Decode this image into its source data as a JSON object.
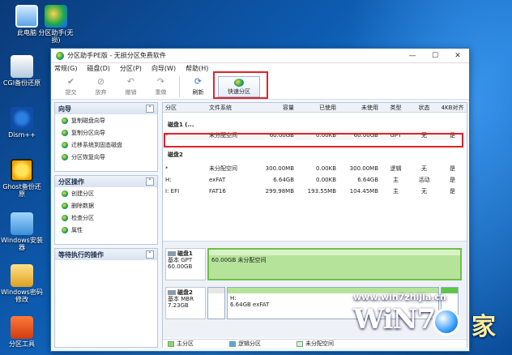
{
  "desktop_icons": [
    {
      "name": "computer",
      "label": "此电脑",
      "icon": "computer-icon"
    },
    {
      "name": "partition-assistant",
      "label": "分区助手(无损)",
      "icon": "partition-icon"
    },
    {
      "name": "cgi",
      "label": "CGI备份还原",
      "icon": "ghost-icon"
    },
    {
      "name": "dism",
      "label": "Dism++",
      "icon": "gear-icon"
    },
    {
      "name": "ghost",
      "label": "Ghost备份还原",
      "icon": "smile-icon"
    },
    {
      "name": "windows-setup",
      "label": "Windows安装器",
      "icon": "setup-icon"
    },
    {
      "name": "windows-password",
      "label": "Windows密码修改",
      "icon": "key-icon"
    },
    {
      "name": "partition-tool",
      "label": "分区工具",
      "icon": "tool-icon"
    }
  ],
  "window": {
    "title": "分区助手PE版 - 无损分区免费软件",
    "menu": [
      "常规(G)",
      "磁盘(D)",
      "分区(P)",
      "向导(W)",
      "帮助(H)"
    ],
    "toolbar": {
      "commit": "提交",
      "discard": "放弃",
      "undo": "撤销",
      "redo": "重做",
      "refresh": "刷新",
      "quick_partition": "快速分区"
    },
    "minimize": "—",
    "maximize": "☐",
    "close": "✕"
  },
  "left_panel": {
    "wizard": {
      "title": "向导",
      "items": [
        "复制磁盘向导",
        "复制分区向导",
        "迁移系统到固态磁盘",
        "分区恢复向导"
      ]
    },
    "partition_ops": {
      "title": "分区操作",
      "items": [
        "创建分区",
        "删除数据",
        "检查分区",
        "属性"
      ]
    },
    "pending": {
      "title": "等待执行的操作"
    }
  },
  "table": {
    "headers": [
      "分区",
      "文件系统",
      "容量",
      "已使用",
      "未使用",
      "类型",
      "状态",
      "4KB对齐"
    ],
    "disk1_label": "磁盘1 (...",
    "disk1_rows": [
      [
        "*",
        "未分配空间",
        "60.00GB",
        "0.00KB",
        "60.00GB",
        "GPT",
        "无",
        "是"
      ]
    ],
    "disk2_label": "磁盘2",
    "disk2_rows": [
      [
        "*",
        "未分配空间",
        "300.00MB",
        "0.00KB",
        "300.00MB",
        "逻辑",
        "无",
        "是"
      ],
      [
        "H:",
        "exFAT",
        "6.64GB",
        "0.00KB",
        "6.64GB",
        "主",
        "活动",
        "是"
      ],
      [
        "I: EFI",
        "FAT16",
        "299.98MB",
        "193.55MB",
        "104.45MB",
        "主",
        "无",
        "是"
      ]
    ]
  },
  "disk_map": {
    "disk1": {
      "name": "磁盘1",
      "type": "基本 GPT",
      "size": "60.00GB",
      "part_text": "60.00GB 未分配空间"
    },
    "disk2": {
      "name": "磁盘2",
      "type": "基本 MBR",
      "size": "7.23GB",
      "part_label": "H:",
      "part_text": "6.64GB exFAT"
    }
  },
  "legend": [
    "主分区",
    "逻辑分区",
    "未分配空间"
  ],
  "watermark": {
    "url": "www.win7zhijia.cn",
    "logo": "WiN7",
    "jia": "家"
  },
  "colors": {
    "selection_border": "#e0232a",
    "primary_partition": "#8fd46a",
    "logical_partition": "#5aa4e8"
  }
}
